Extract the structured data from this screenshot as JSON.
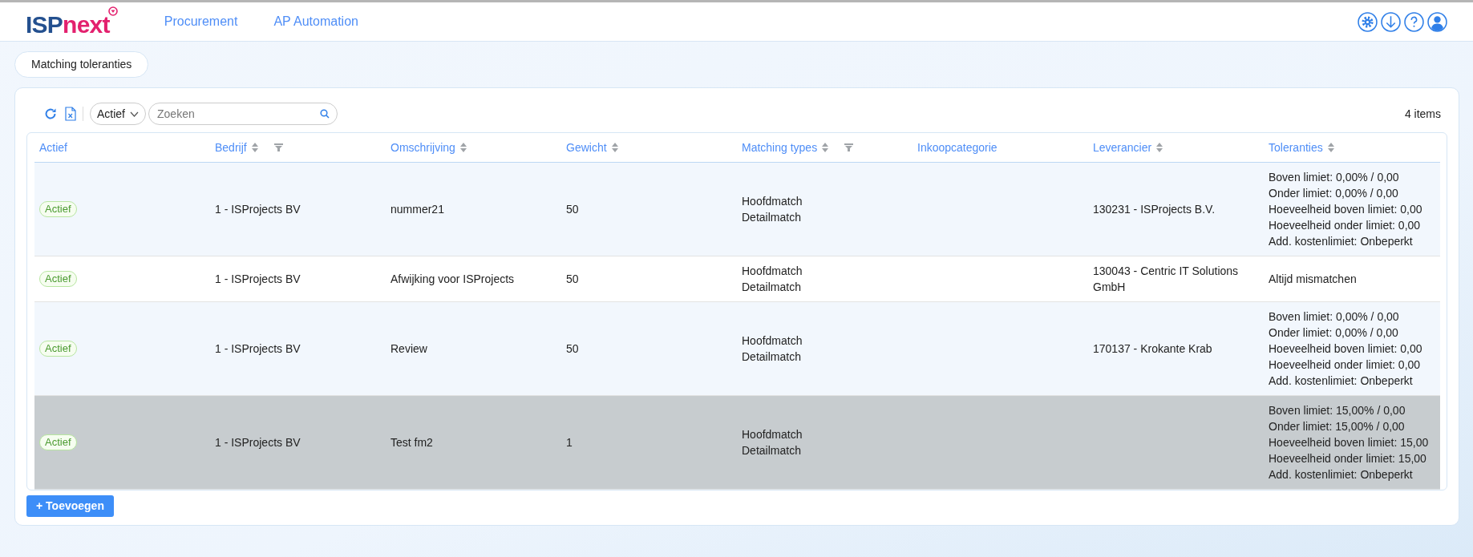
{
  "header": {
    "logo": {
      "part_1": "ISP",
      "part_2": "next"
    },
    "nav": [
      {
        "label": "Procurement"
      },
      {
        "label": "AP Automation"
      }
    ]
  },
  "page_tab": {
    "label": "Matching toleranties"
  },
  "toolbar": {
    "status_filter": "Actief",
    "search": {
      "placeholder": "Zoeken"
    },
    "count": "4 items"
  },
  "table": {
    "columns": [
      {
        "label": "Actief",
        "sortable": false,
        "filterable": false
      },
      {
        "label": "Bedrijf",
        "sortable": true,
        "filterable": true
      },
      {
        "label": "Omschrijving",
        "sortable": true,
        "filterable": false
      },
      {
        "label": "Gewicht",
        "sortable": true,
        "filterable": false
      },
      {
        "label": "Matching types",
        "sortable": true,
        "filterable": true
      },
      {
        "label": "Inkoopcategorie",
        "sortable": false,
        "filterable": false
      },
      {
        "label": "Leverancier",
        "sortable": true,
        "filterable": false
      },
      {
        "label": "Toleranties",
        "sortable": true,
        "filterable": false
      }
    ],
    "rows": [
      {
        "selected": false,
        "status": "Actief",
        "bedrijf": "1 - ISProjects BV",
        "omschrijving": "nummer21",
        "gewicht": "50",
        "matching_types": [
          "Hoofdmatch",
          "Detailmatch"
        ],
        "leverancier": "130231 - ISProjects B.V.",
        "toleranties": [
          "Boven limiet: 0,00% / 0,00",
          "Onder limiet: 0,00% / 0,00",
          "Hoeveelheid boven limiet: 0,00",
          "Hoeveelheid onder limiet: 0,00",
          "Add. kostenlimiet: Onbeperkt"
        ]
      },
      {
        "selected": false,
        "status": "Actief",
        "bedrijf": "1 - ISProjects BV",
        "omschrijving": "Afwijking voor ISProjects",
        "gewicht": "50",
        "matching_types": [
          "Hoofdmatch",
          "Detailmatch"
        ],
        "leverancier": "130043 - Centric IT Solutions GmbH",
        "toleranties": [
          "Altijd mismatchen"
        ]
      },
      {
        "selected": false,
        "status": "Actief",
        "bedrijf": "1 - ISProjects BV",
        "omschrijving": "Review",
        "gewicht": "50",
        "matching_types": [
          "Hoofdmatch",
          "Detailmatch"
        ],
        "leverancier": "170137 - Krokante Krab",
        "toleranties": [
          "Boven limiet: 0,00% / 0,00",
          "Onder limiet: 0,00% / 0,00",
          "Hoeveelheid boven limiet: 0,00",
          "Hoeveelheid onder limiet: 0,00",
          "Add. kostenlimiet: Onbeperkt"
        ]
      },
      {
        "selected": true,
        "status": "Actief",
        "bedrijf": "1 - ISProjects BV",
        "omschrijving": "Test fm2",
        "gewicht": "1",
        "matching_types": [
          "Hoofdmatch",
          "Detailmatch"
        ],
        "toleranties": [
          "Boven limiet: 15,00% / 0,00",
          "Onder limiet: 15,00% / 0,00",
          "Hoeveelheid boven limiet: 15,00",
          "Hoeveelheid onder limiet: 15,00",
          "Add. kostenlimiet: Onbeperkt"
        ]
      }
    ]
  },
  "add_button": {
    "label": "+ Toevoegen"
  }
}
